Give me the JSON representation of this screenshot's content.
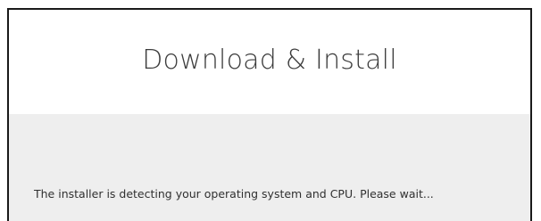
{
  "dialog": {
    "title": "Download & Install",
    "status_message": "The installer is detecting your operating system and CPU. Please wait..."
  }
}
